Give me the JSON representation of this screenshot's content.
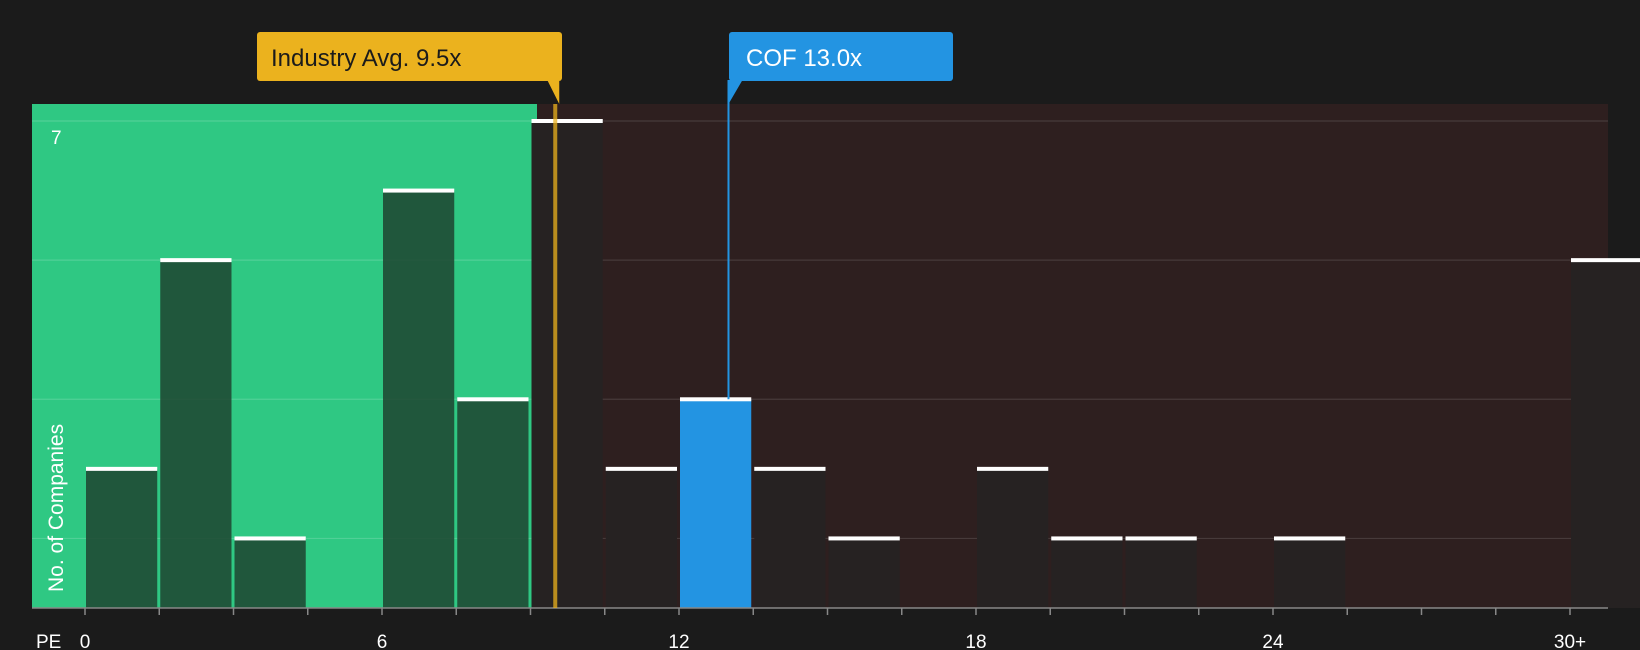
{
  "colors": {
    "background": "#1b1b1b",
    "below_zone": "#2fc883",
    "above_zone": "#2e1f1f",
    "bar_below": "#1f4a34",
    "bar_above": "#262222",
    "highlight": "#2394e2",
    "industry": "#ebb21e",
    "cap": "#ffffff"
  },
  "chart_data": {
    "type": "bar",
    "xlabel": "PE",
    "ylabel": "No. of Companies",
    "y_tick_label": "7",
    "ylim": [
      0,
      7
    ],
    "x_ticks": [
      {
        "value": 0,
        "label": "0"
      },
      {
        "value": 6,
        "label": "6"
      },
      {
        "value": 12,
        "label": "12"
      },
      {
        "value": 18,
        "label": "18"
      },
      {
        "value": 24,
        "label": "24"
      },
      {
        "value": 30,
        "label": "30+"
      }
    ],
    "bin_width": 1.5,
    "bins": [
      {
        "start": 0,
        "count": 2
      },
      {
        "start": 1.5,
        "count": 5
      },
      {
        "start": 3,
        "count": 1
      },
      {
        "start": 4.5,
        "count": 0
      },
      {
        "start": 6,
        "count": 6
      },
      {
        "start": 7.5,
        "count": 3
      },
      {
        "start": 9,
        "count": 7
      },
      {
        "start": 10.5,
        "count": 2
      },
      {
        "start": 12,
        "count": 3,
        "highlight": true
      },
      {
        "start": 13.5,
        "count": 2
      },
      {
        "start": 15,
        "count": 1
      },
      {
        "start": 16.5,
        "count": 0
      },
      {
        "start": 18,
        "count": 2
      },
      {
        "start": 19.5,
        "count": 1
      },
      {
        "start": 21,
        "count": 1
      },
      {
        "start": 22.5,
        "count": 0
      },
      {
        "start": 24,
        "count": 1
      },
      {
        "start": 25.5,
        "count": 0
      },
      {
        "start": 27,
        "count": 0
      },
      {
        "start": 28.5,
        "count": 0
      },
      {
        "start": 30,
        "count": 5
      }
    ],
    "industry_avg": {
      "value": 9.5,
      "label": "Industry Avg. 9.5x"
    },
    "company": {
      "value": 13.0,
      "label": "COF 13.0x"
    }
  }
}
